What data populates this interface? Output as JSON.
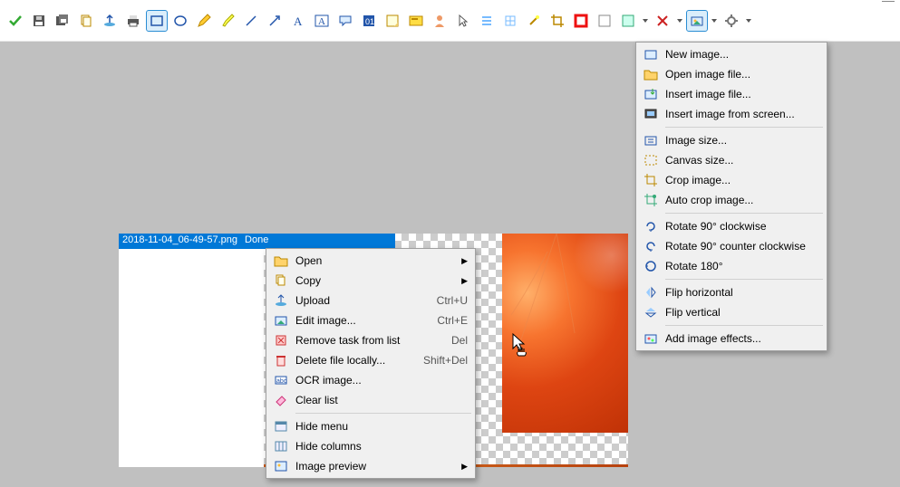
{
  "file": {
    "name": "2018-11-04_06-49-57.png",
    "status": "Done"
  },
  "toolbar": [
    {
      "id": "confirm",
      "name": "check-icon"
    },
    {
      "id": "save",
      "name": "floppy-icon"
    },
    {
      "id": "saveas",
      "name": "floppy-multi-icon"
    },
    {
      "id": "copy",
      "name": "copy-icon"
    },
    {
      "id": "upload",
      "name": "upload-icon"
    },
    {
      "id": "print",
      "name": "printer-icon"
    },
    {
      "id": "rect",
      "name": "rectangle-select-icon",
      "highlight": true
    },
    {
      "id": "ellipse",
      "name": "ellipse-select-icon"
    },
    {
      "id": "pencil",
      "name": "pencil-icon"
    },
    {
      "id": "marker",
      "name": "marker-icon"
    },
    {
      "id": "line",
      "name": "line-icon"
    },
    {
      "id": "arrow",
      "name": "arrow-icon"
    },
    {
      "id": "text",
      "name": "text-a-icon"
    },
    {
      "id": "text-outline",
      "name": "text-a-box-icon"
    },
    {
      "id": "speech",
      "name": "speech-bubble-icon"
    },
    {
      "id": "stepnum",
      "name": "step-number-icon"
    },
    {
      "id": "sticker",
      "name": "sticker-icon"
    },
    {
      "id": "slide",
      "name": "slide-icon"
    },
    {
      "id": "person",
      "name": "person-icon"
    },
    {
      "id": "pointer",
      "name": "pointer-icon"
    },
    {
      "id": "bars",
      "name": "bars-icon"
    },
    {
      "id": "grid",
      "name": "grid-icon"
    },
    {
      "id": "magic",
      "name": "wand-icon"
    },
    {
      "id": "crop",
      "name": "crop-icon"
    },
    {
      "id": "red-frame",
      "name": "red-frame-icon"
    },
    {
      "id": "white-frame",
      "name": "white-frame-icon"
    },
    {
      "id": "sticky",
      "name": "sticky-note-icon",
      "drop": true
    },
    {
      "id": "tools",
      "name": "tools-cross-icon",
      "drop": true
    },
    {
      "id": "image-menu",
      "name": "image-menu-icon",
      "drop": true,
      "active": true
    },
    {
      "id": "gear",
      "name": "gear-icon",
      "drop": true
    }
  ],
  "task_menu": {
    "items": [
      {
        "label": "Open",
        "icon": "folder-icon",
        "submenu": true
      },
      {
        "label": "Copy",
        "icon": "copy-icon",
        "submenu": true
      },
      {
        "label": "Upload",
        "icon": "upload-icon",
        "shortcut": "Ctrl+U"
      },
      {
        "label": "Edit image...",
        "icon": "edit-image-icon",
        "shortcut": "Ctrl+E"
      },
      {
        "label": "Remove task from list",
        "icon": "remove-task-icon",
        "shortcut": "Del"
      },
      {
        "label": "Delete file locally...",
        "icon": "delete-file-icon",
        "shortcut": "Shift+Del"
      },
      {
        "label": "OCR image...",
        "icon": "ocr-icon"
      },
      {
        "label": "Clear list",
        "icon": "eraser-icon"
      }
    ],
    "items2": [
      {
        "label": "Hide menu",
        "icon": "hide-menu-icon"
      },
      {
        "label": "Hide columns",
        "icon": "hide-columns-icon"
      },
      {
        "label": "Image preview",
        "icon": "image-preview-icon",
        "submenu": true
      }
    ]
  },
  "image_menu": {
    "g1": [
      {
        "label": "New image...",
        "icon": "new-image-icon"
      },
      {
        "label": "Open image file...",
        "icon": "open-image-icon"
      },
      {
        "label": "Insert image file...",
        "icon": "insert-image-icon"
      },
      {
        "label": "Insert image from screen...",
        "icon": "insert-screen-icon"
      }
    ],
    "g2": [
      {
        "label": "Image size...",
        "icon": "image-size-icon"
      },
      {
        "label": "Canvas size...",
        "icon": "canvas-size-icon"
      },
      {
        "label": "Crop image...",
        "icon": "crop-image-icon"
      },
      {
        "label": "Auto crop image...",
        "icon": "auto-crop-icon"
      }
    ],
    "g3": [
      {
        "label": "Rotate 90° clockwise",
        "icon": "rotate-cw-icon"
      },
      {
        "label": "Rotate 90° counter clockwise",
        "icon": "rotate-ccw-icon"
      },
      {
        "label": "Rotate 180°",
        "icon": "rotate-180-icon"
      }
    ],
    "g4": [
      {
        "label": "Flip horizontal",
        "icon": "flip-h-icon"
      },
      {
        "label": "Flip vertical",
        "icon": "flip-v-icon"
      }
    ],
    "g5": [
      {
        "label": "Add image effects...",
        "icon": "effects-icon"
      }
    ]
  }
}
